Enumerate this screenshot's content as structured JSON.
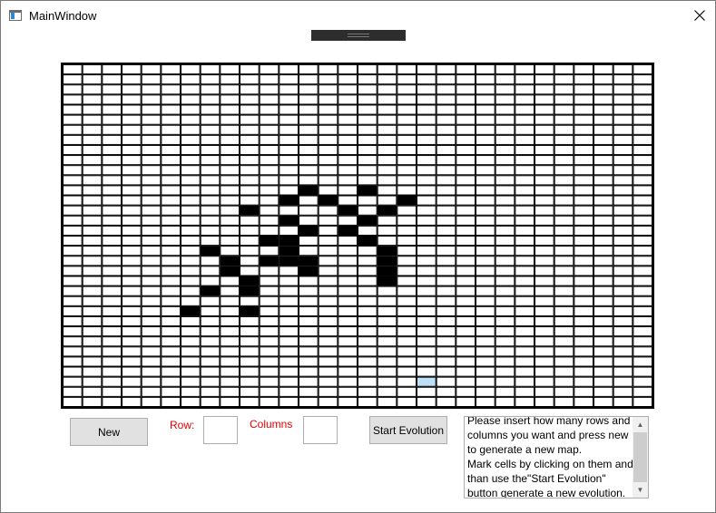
{
  "window": {
    "title": "MainWindow",
    "icon": "app-window-icon",
    "close_icon": "close-icon"
  },
  "controls": {
    "new_label": "New",
    "row_label": "Row:",
    "columns_label": "Columns",
    "row_value": "",
    "columns_value": "",
    "start_label": "Start Evolution"
  },
  "info": {
    "text": "Please insert how many rows and columns you want and press new to generate a new map.\nMark cells by clicking on them and than use the\"Start Evolution\" button generate a new evolution."
  },
  "grid": {
    "rows": 34,
    "columns": 30,
    "alive_color": "#000000",
    "dead_color": "#ffffff",
    "line_color": "#000000",
    "highlight_color": "#bde0f7",
    "alive_cells": [
      [
        12,
        12
      ],
      [
        12,
        15
      ],
      [
        13,
        11
      ],
      [
        13,
        13
      ],
      [
        13,
        17
      ],
      [
        14,
        9
      ],
      [
        14,
        14
      ],
      [
        14,
        16
      ],
      [
        15,
        11
      ],
      [
        15,
        15
      ],
      [
        16,
        12
      ],
      [
        16,
        14
      ],
      [
        17,
        10
      ],
      [
        17,
        11
      ],
      [
        17,
        15
      ],
      [
        18,
        7
      ],
      [
        18,
        11
      ],
      [
        18,
        16
      ],
      [
        19,
        8
      ],
      [
        19,
        10
      ],
      [
        19,
        11
      ],
      [
        19,
        12
      ],
      [
        19,
        16
      ],
      [
        20,
        8
      ],
      [
        20,
        12
      ],
      [
        20,
        16
      ],
      [
        21,
        9
      ],
      [
        21,
        16
      ],
      [
        22,
        7
      ],
      [
        22,
        9
      ],
      [
        24,
        6
      ],
      [
        24,
        9
      ]
    ],
    "highlight_cells": [
      [
        31,
        18
      ]
    ]
  }
}
